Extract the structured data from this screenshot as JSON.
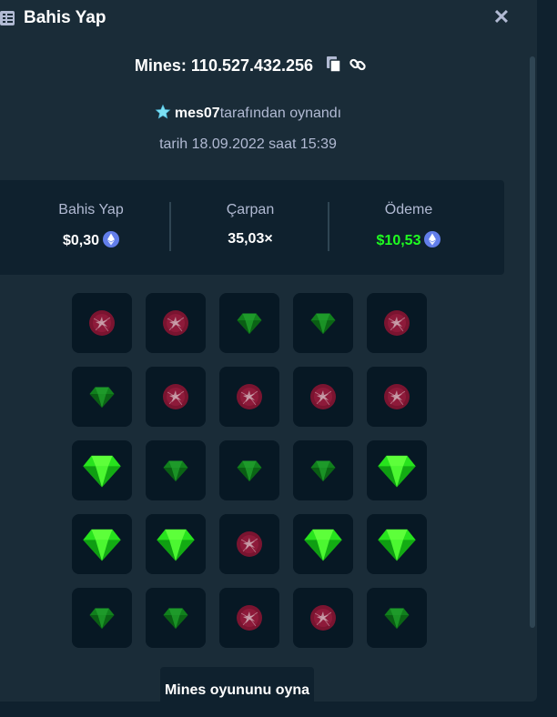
{
  "header": {
    "title": "Bahis Yap",
    "close_label": "✕",
    "menu_icon": "bet-slip-icon",
    "close_icon": "close-icon"
  },
  "game": {
    "title": "Mines: 110.527.432.256",
    "copy_icon": "copy-icon",
    "link_icon": "link-icon"
  },
  "player": {
    "icon": "star-icon",
    "name": "mes07",
    "suffix": "tarafından oynandı"
  },
  "date_text": "tarih 18.09.2022 saat 15:39",
  "stats": {
    "bet": {
      "label": "Bahis Yap",
      "value": "$0,30",
      "currency_icon": "ethereum-icon"
    },
    "multiplier": {
      "label": "Çarpan",
      "value": "35,03×"
    },
    "payout": {
      "label": "Ödeme",
      "value": "$10,53",
      "currency_icon": "ethereum-icon"
    }
  },
  "board": {
    "rows": [
      [
        "mine",
        "mine",
        "gem-dim",
        "gem-dim",
        "mine"
      ],
      [
        "gem-dim",
        "mine",
        "mine",
        "mine",
        "mine"
      ],
      [
        "gem",
        "gem-dim",
        "gem-dim",
        "gem-dim",
        "gem"
      ],
      [
        "gem",
        "gem",
        "mine",
        "gem",
        "gem"
      ],
      [
        "gem-dim",
        "gem-dim",
        "mine",
        "mine",
        "gem-dim"
      ]
    ]
  },
  "play_button": "Mines oyununu oyna",
  "colors": {
    "background": "#0f212e",
    "panel": "#1a2c38",
    "muted_text": "#b1bad3",
    "payout_green": "#1fff20",
    "gem_bright": "#1fdb1f",
    "gem_dim": "#0f7a1c",
    "mine_red": "#7a1430",
    "ethereum": "#627eea"
  }
}
